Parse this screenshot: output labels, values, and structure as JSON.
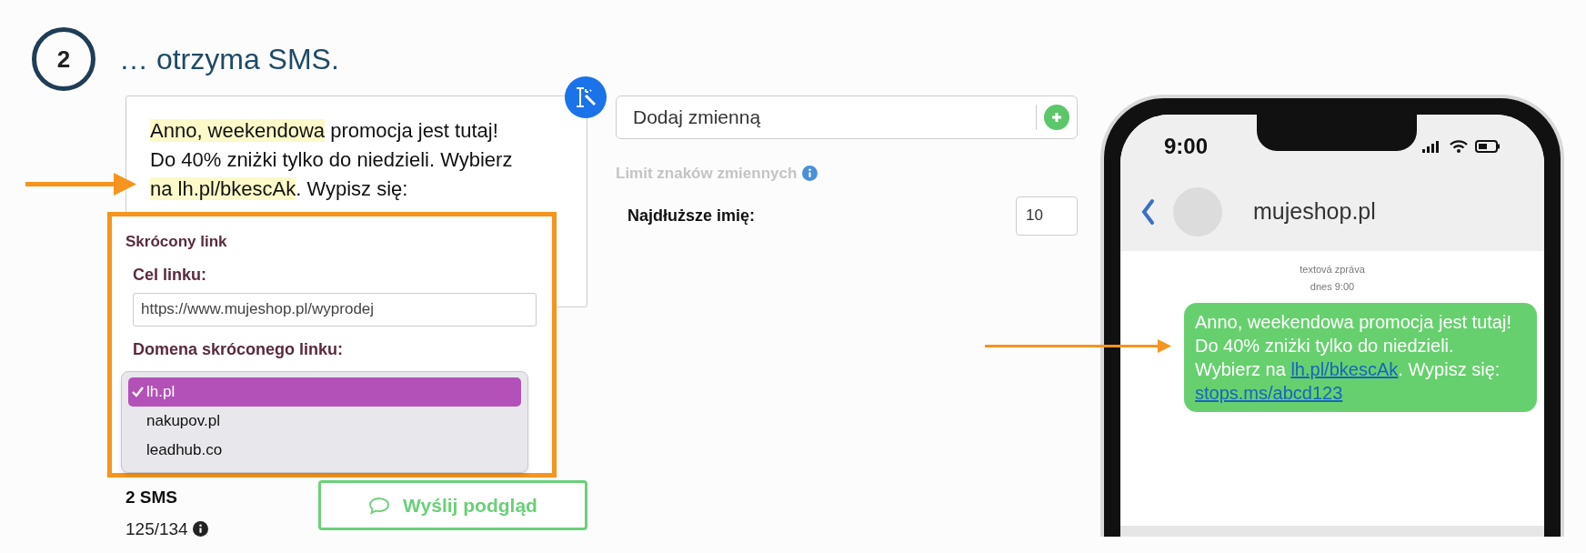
{
  "step": {
    "number": "2",
    "title": "… otrzyma SMS."
  },
  "editor": {
    "message": [
      {
        "kind": "variable",
        "text": "Anno, weekendowa"
      },
      {
        "kind": "plain",
        "text": " promocja jest tutaj! Do 40% zniżki tylko do niedzieli. Wybierz "
      },
      {
        "kind": "link",
        "text": "na lh.pl/bkescAk"
      },
      {
        "kind": "plain",
        "text": ". Wypisz się:"
      }
    ]
  },
  "link_popup": {
    "title": "Skrócony link",
    "target_label": "Cel linku:",
    "target_value": "https://www.mujeshop.pl/wyprodej",
    "domain_label": "Domena skróconego linku:",
    "domains": [
      {
        "label": "lh.pl",
        "selected": true
      },
      {
        "label": "nakupov.pl",
        "selected": false
      },
      {
        "label": "leadhub.co",
        "selected": false
      }
    ]
  },
  "counter": {
    "parts": "2 SMS",
    "chars": "125/134"
  },
  "preview_button": "Wyślij podgląd",
  "variables": {
    "placeholder": "Dodaj zmienną",
    "limit_title": "Limit znaków zmiennych",
    "fields": [
      {
        "label": "Najdłuższe imię:",
        "value": "10"
      }
    ]
  },
  "phone": {
    "time": "9:00",
    "contact": "mujeshop.pl",
    "meta": [
      "textová zpráva",
      "dnes 9:00"
    ],
    "message": [
      {
        "kind": "plain",
        "text": "Anno, weekendowa promocja jest tutaj! Do 40% zniżki tylko do niedzieli. Wybierz na "
      },
      {
        "kind": "link",
        "text": "lh.pl/bkescAk"
      },
      {
        "kind": "plain",
        "text": ". Wypisz się: "
      },
      {
        "kind": "link",
        "text": "stops.ms/abcd123"
      }
    ]
  }
}
